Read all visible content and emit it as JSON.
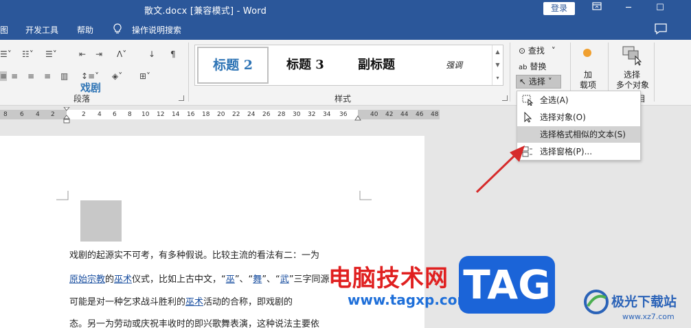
{
  "titlebar": {
    "title": "散文.docx [兼容模式] - Word",
    "login": "登录",
    "restore_icon": "ribbon-display-icon",
    "minimize": "─",
    "maximize": "☐"
  },
  "menu": {
    "items": [
      "图",
      "开发工具",
      "帮助",
      "操作说明搜索"
    ]
  },
  "ribbon": {
    "paragraph_label": "段落",
    "styles_label": "样式",
    "styles": [
      "标题 2",
      "标题 3",
      "副标题",
      "强调"
    ],
    "find": "查找",
    "replace": "替换",
    "select": "选择",
    "add_line1": "加",
    "add_line2": "载项",
    "select_multi_line1": "选择",
    "select_multi_line2": "多个对象",
    "group_tail": "目"
  },
  "ruler": {
    "ticks": [
      "8",
      "6",
      "4",
      "2",
      "2",
      "4",
      "6",
      "8",
      "10",
      "12",
      "14",
      "16",
      "18",
      "20",
      "22",
      "24",
      "26",
      "28",
      "30",
      "32",
      "34",
      "36",
      "40",
      "42",
      "44",
      "46",
      "48"
    ]
  },
  "dropdown": {
    "items": [
      {
        "label": "全选(A)",
        "icon": "select-all-icon"
      },
      {
        "label": "选择对象(O)",
        "icon": "cursor-arrow-icon"
      },
      {
        "label": "选择格式相似的文本(S)",
        "icon": ""
      },
      {
        "label": "选择窗格(P)...",
        "icon": "selection-pane-icon"
      }
    ]
  },
  "document": {
    "heading": "戏剧",
    "line1": "戏剧的起源实不可考，有多种假说。比较主流的看法有二：一为",
    "line2_link1": "原始宗教",
    "line2_mid1": "的",
    "line2_link2": "巫术",
    "line2_mid2": "仪式，比如上古中文，“",
    "line2_link3": "巫",
    "line2_mid3": "”、“",
    "line2_link4": "舞",
    "line2_mid4": "”、“",
    "line2_link5": "武",
    "line2_tail": "”三字同源",
    "line3_pre": "可能是对一种乞求战斗胜利的",
    "line3_link": "巫术",
    "line3_tail": "活动的合称，即戏剧的",
    "line4": "态。另一为劳动或庆祝丰收时的即兴歌舞表演，这种说法主要依"
  },
  "watermark": {
    "cn": "电脑技术网",
    "url": "www.tagxp.com",
    "tag": "TAG",
    "brand": "极光下载站",
    "brand_url": "www.xz7.com"
  }
}
